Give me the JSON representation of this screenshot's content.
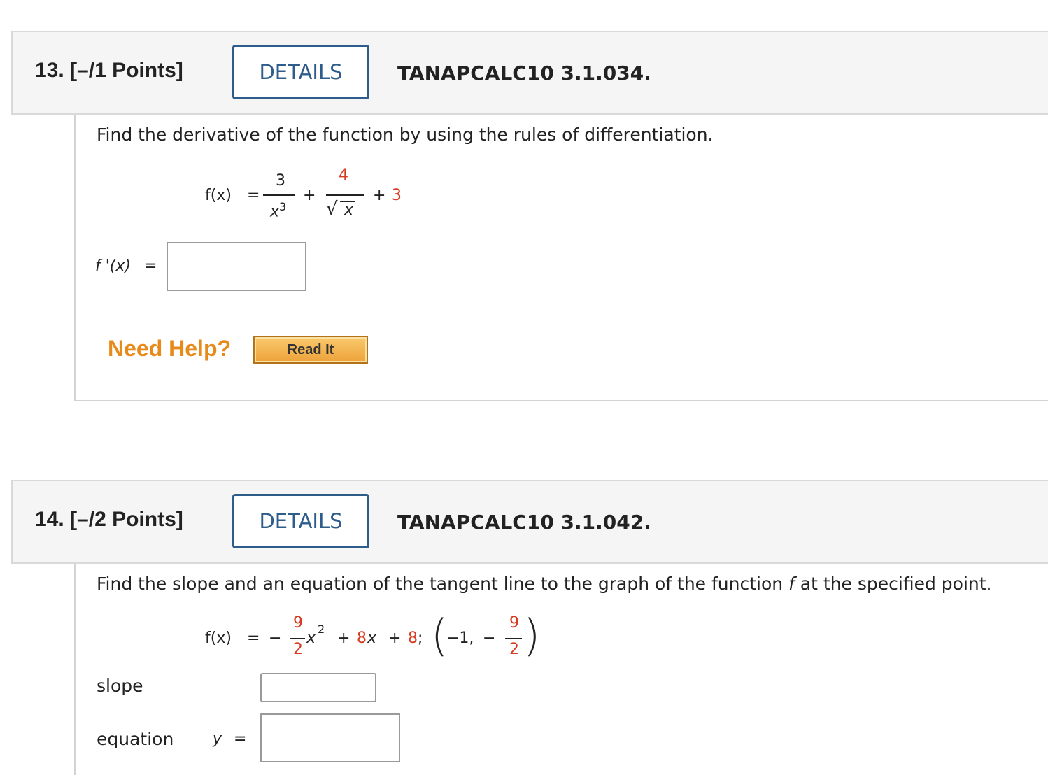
{
  "q13": {
    "number": "13.",
    "points": "[–/1 Points]",
    "details_label": "DETAILS",
    "problem_id": "TANAPCALC10 3.1.034.",
    "prompt": "Find the derivative of the function by using the rules of differentiation.",
    "equation": {
      "lhs": "f(x)",
      "equals": "=",
      "term1_num": "3",
      "term1_den": "x",
      "term1_den_exp": "3",
      "plus1": "+",
      "term2_num": "4",
      "term2_den_radical": "√",
      "term2_den": "x",
      "plus2": "+",
      "const": "3"
    },
    "answer_label": "f '(x)",
    "answer_equals": "=",
    "answer_value": "",
    "need_help": "Need Help?",
    "read_it": "Read It"
  },
  "q14": {
    "number": "14.",
    "points": "[–/2 Points]",
    "details_label": "DETAILS",
    "problem_id": "TANAPCALC10 3.1.042.",
    "prompt_before": "Find the slope and an equation of the tangent line to the graph of the function ",
    "prompt_var": "f",
    "prompt_after": " at the specified point.",
    "equation": {
      "lhs": "f(x)",
      "equals": "=",
      "minus": "−",
      "coef_num": "9",
      "coef_den": "2",
      "var": "x",
      "exp": "2",
      "plus1": "+",
      "b": "8",
      "var2": "x",
      "plus2": "+",
      "c": "8",
      "semicolon": ";",
      "point_x": "−1,",
      "point_minus": "−",
      "point_y_num": "9",
      "point_y_den": "2",
      "lparen": "(",
      "rparen": ")"
    },
    "slope_label": "slope",
    "slope_value": "",
    "equation_label": "equation",
    "y_label": "y",
    "y_equals": "=",
    "equation_value": ""
  },
  "colors": {
    "details_border": "#2e5d8c",
    "highlight_red": "#d63a1f",
    "need_help_orange": "#e88a1a"
  }
}
